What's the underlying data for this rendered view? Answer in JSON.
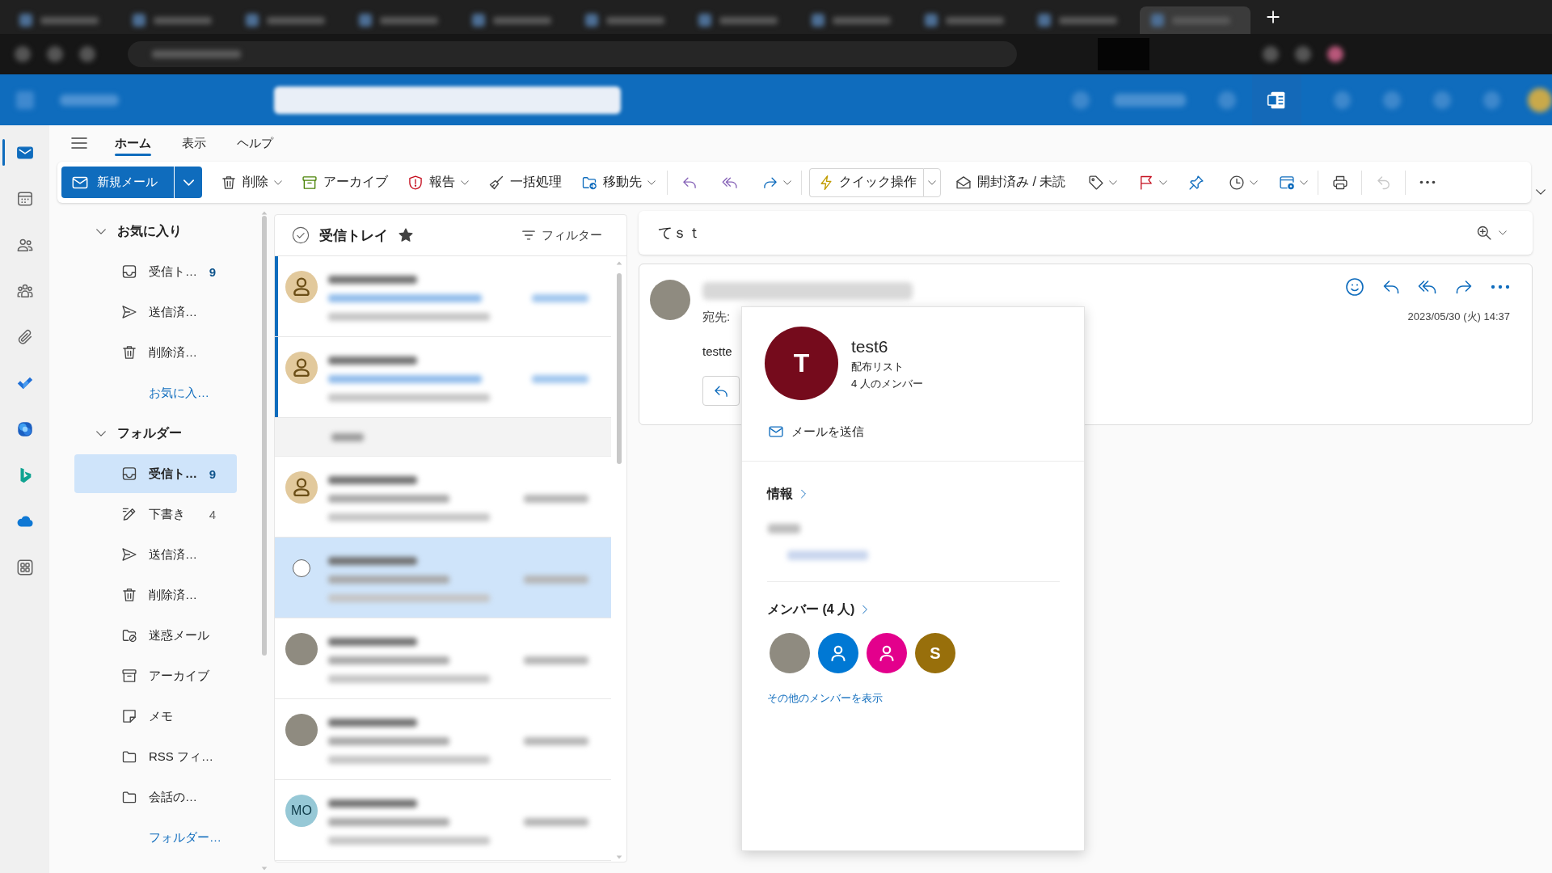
{
  "browser": {
    "tabs": [
      {
        "selected": false
      },
      {
        "selected": false
      },
      {
        "selected": false
      },
      {
        "selected": false
      },
      {
        "selected": false
      },
      {
        "selected": false
      },
      {
        "selected": false
      },
      {
        "selected": false
      },
      {
        "selected": false
      },
      {
        "selected": false
      },
      {
        "selected": true
      }
    ]
  },
  "app_rail": {
    "items": [
      {
        "kind": "mail",
        "selected": true
      },
      {
        "kind": "calendar",
        "selected": false
      },
      {
        "kind": "people",
        "selected": false
      },
      {
        "kind": "groups",
        "selected": false
      },
      {
        "kind": "files",
        "selected": false
      },
      {
        "kind": "todo",
        "selected": false
      },
      {
        "kind": "m365",
        "selected": false
      },
      {
        "kind": "bing",
        "selected": false
      },
      {
        "kind": "onedrive",
        "selected": false
      },
      {
        "kind": "apps",
        "selected": false
      }
    ]
  },
  "ribbon_tabs": [
    {
      "label": "ホーム",
      "selected": true
    },
    {
      "label": "表示",
      "selected": false
    },
    {
      "label": "ヘルプ",
      "selected": false
    }
  ],
  "toolbar": {
    "new_mail": {
      "label": "新規メール"
    },
    "items": [
      {
        "kind": "delete",
        "label": "削除",
        "dropdown": true,
        "disabled": false
      },
      {
        "kind": "archive",
        "label": "アーカイブ",
        "dropdown": false,
        "disabled": false
      },
      {
        "kind": "report",
        "label": "報告",
        "dropdown": true,
        "disabled": false
      },
      {
        "kind": "sweep",
        "label": "一括処理",
        "dropdown": false,
        "disabled": false
      },
      {
        "kind": "move",
        "label": "移動先",
        "dropdown": true,
        "disabled": false
      },
      {
        "kind": "divider"
      },
      {
        "kind": "reply",
        "dropdown": false,
        "disabled": false
      },
      {
        "kind": "replyall",
        "dropdown": false,
        "disabled": false
      },
      {
        "kind": "forward",
        "dropdown": true,
        "disabled": false
      },
      {
        "kind": "divider"
      },
      {
        "kind": "quick",
        "label": "クイック操作",
        "dropdown": true,
        "disabled": false
      },
      {
        "kind": "read",
        "label": "開封済み / 未読",
        "dropdown": false,
        "disabled": false
      },
      {
        "kind": "tag",
        "dropdown": true,
        "disabled": false
      },
      {
        "kind": "flag",
        "dropdown": true,
        "disabled": false
      },
      {
        "kind": "pin",
        "dropdown": false,
        "disabled": false
      },
      {
        "kind": "snooze",
        "dropdown": true,
        "disabled": false
      },
      {
        "kind": "rules",
        "dropdown": true,
        "disabled": false
      },
      {
        "kind": "divider"
      },
      {
        "kind": "print",
        "dropdown": false,
        "disabled": false
      },
      {
        "kind": "divider"
      },
      {
        "kind": "undo",
        "dropdown": false,
        "disabled": true
      },
      {
        "kind": "divider"
      },
      {
        "kind": "more",
        "dropdown": false,
        "disabled": false
      }
    ]
  },
  "folders": {
    "sections": [
      {
        "title": "お気に入り",
        "expanded": true,
        "items": [
          {
            "kind": "inbox",
            "label": "受信ト…",
            "count": {
              "text": "9",
              "unread": true
            },
            "selected": false
          },
          {
            "kind": "sent",
            "label": "送信済…",
            "selected": false
          },
          {
            "kind": "deleted",
            "label": "削除済…",
            "selected": false
          }
        ],
        "more_link": "お気に入…"
      },
      {
        "title": "フォルダー",
        "expanded": true,
        "items": [
          {
            "kind": "inbox",
            "label": "受信ト…",
            "count": {
              "text": "9",
              "unread": true
            },
            "selected": true
          },
          {
            "kind": "drafts",
            "label": "下書き",
            "count": {
              "text": "4",
              "unread": false
            },
            "selected": false
          },
          {
            "kind": "sent",
            "label": "送信済…",
            "selected": false
          },
          {
            "kind": "deleted",
            "label": "削除済…",
            "selected": false
          },
          {
            "kind": "junk",
            "label": "迷惑メール",
            "selected": false
          },
          {
            "kind": "archive",
            "label": "アーカイブ",
            "selected": false
          },
          {
            "kind": "notes",
            "label": "メモ",
            "selected": false
          },
          {
            "kind": "folder",
            "label": "RSS フィ…",
            "selected": false
          },
          {
            "kind": "folder",
            "label": "会話の…",
            "selected": false
          }
        ],
        "more_link": "フォルダー…"
      }
    ]
  },
  "message_list": {
    "title": "受信トレイ",
    "favorite": true,
    "filter_label": "フィルター",
    "rows": [
      {
        "kind": "message",
        "avatar": {
          "kind": "person"
        },
        "unread": true,
        "selected": false
      },
      {
        "kind": "message",
        "avatar": {
          "kind": "person"
        },
        "unread": true,
        "selected": false
      },
      {
        "kind": "group"
      },
      {
        "kind": "message",
        "avatar": {
          "kind": "person"
        },
        "unread": false,
        "selected": false
      },
      {
        "kind": "message",
        "unread": false,
        "selected": true
      },
      {
        "kind": "message",
        "avatar": {
          "kind": "photo"
        },
        "unread": false,
        "selected": false
      },
      {
        "kind": "message",
        "avatar": {
          "kind": "photo"
        },
        "unread": false,
        "selected": false
      },
      {
        "kind": "message",
        "avatar": {
          "kind": "initials",
          "initials": "MO"
        },
        "unread": false,
        "selected": false
      }
    ]
  },
  "reading_pane": {
    "subject": "てｓｔ",
    "message": {
      "to_label": "宛先:",
      "date": "2023/05/30 (火) 14:37",
      "body": "testte"
    }
  },
  "contact_card": {
    "initial": "T",
    "name": "test6",
    "type": "配布リスト",
    "member_count": "4 人のメンバー",
    "send_mail": "メールを送信",
    "info_title": "情報",
    "members_title": "メンバー (4 人)",
    "members": [
      {
        "kind": "photo"
      },
      {
        "kind": "person",
        "color": "#0078d4"
      },
      {
        "kind": "person",
        "color": "#e3008c"
      },
      {
        "kind": "initials",
        "initial": "S",
        "color": "#986f0b"
      }
    ],
    "show_more": "その他のメンバーを表示"
  }
}
